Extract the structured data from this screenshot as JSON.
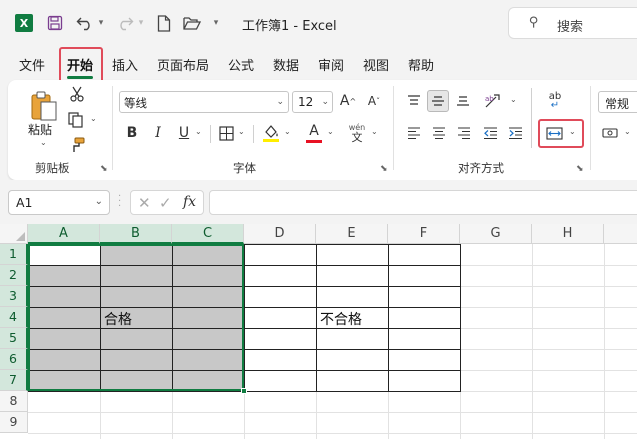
{
  "app": {
    "logo_letter": "X",
    "title": "工作簿1  -  Excel",
    "search_placeholder": "搜索",
    "accent_color": "#107c41",
    "highlight_color": "#e04b5a"
  },
  "titlebar_icons": [
    "save-icon",
    "undo-icon",
    "redo-icon",
    "new-file-icon",
    "open-folder-icon"
  ],
  "tabs": [
    {
      "label": "文件"
    },
    {
      "label": "开始",
      "active": true
    },
    {
      "label": "插入"
    },
    {
      "label": "页面布局"
    },
    {
      "label": "公式"
    },
    {
      "label": "数据"
    },
    {
      "label": "审阅"
    },
    {
      "label": "视图"
    },
    {
      "label": "帮助"
    }
  ],
  "ribbon": {
    "clipboard": {
      "label": "剪贴板",
      "paste_label": "粘贴"
    },
    "font": {
      "label": "字体",
      "font_name": "等线",
      "font_size": "12",
      "phonetic_top": "wén",
      "phonetic_bottom": "文",
      "bold": "B",
      "italic": "I",
      "underline": "U",
      "font_color_letter": "A",
      "grow": "A",
      "shrink": "A"
    },
    "alignment": {
      "label": "对齐方式",
      "wrap_label": "ab"
    },
    "number": {
      "format": "常规"
    }
  },
  "formula_bar": {
    "name_box": "A1",
    "fx_label": "fx",
    "formula": ""
  },
  "sheet": {
    "columns": [
      "A",
      "B",
      "C",
      "D",
      "E",
      "F",
      "G",
      "H"
    ],
    "rows": [
      "1",
      "2",
      "3",
      "4",
      "5",
      "6",
      "7",
      "8",
      "9"
    ],
    "selected_range": "A1:C7",
    "fill_color": "#c8c8c8",
    "cells": {
      "B4": "合格",
      "E4": "不合格"
    }
  }
}
